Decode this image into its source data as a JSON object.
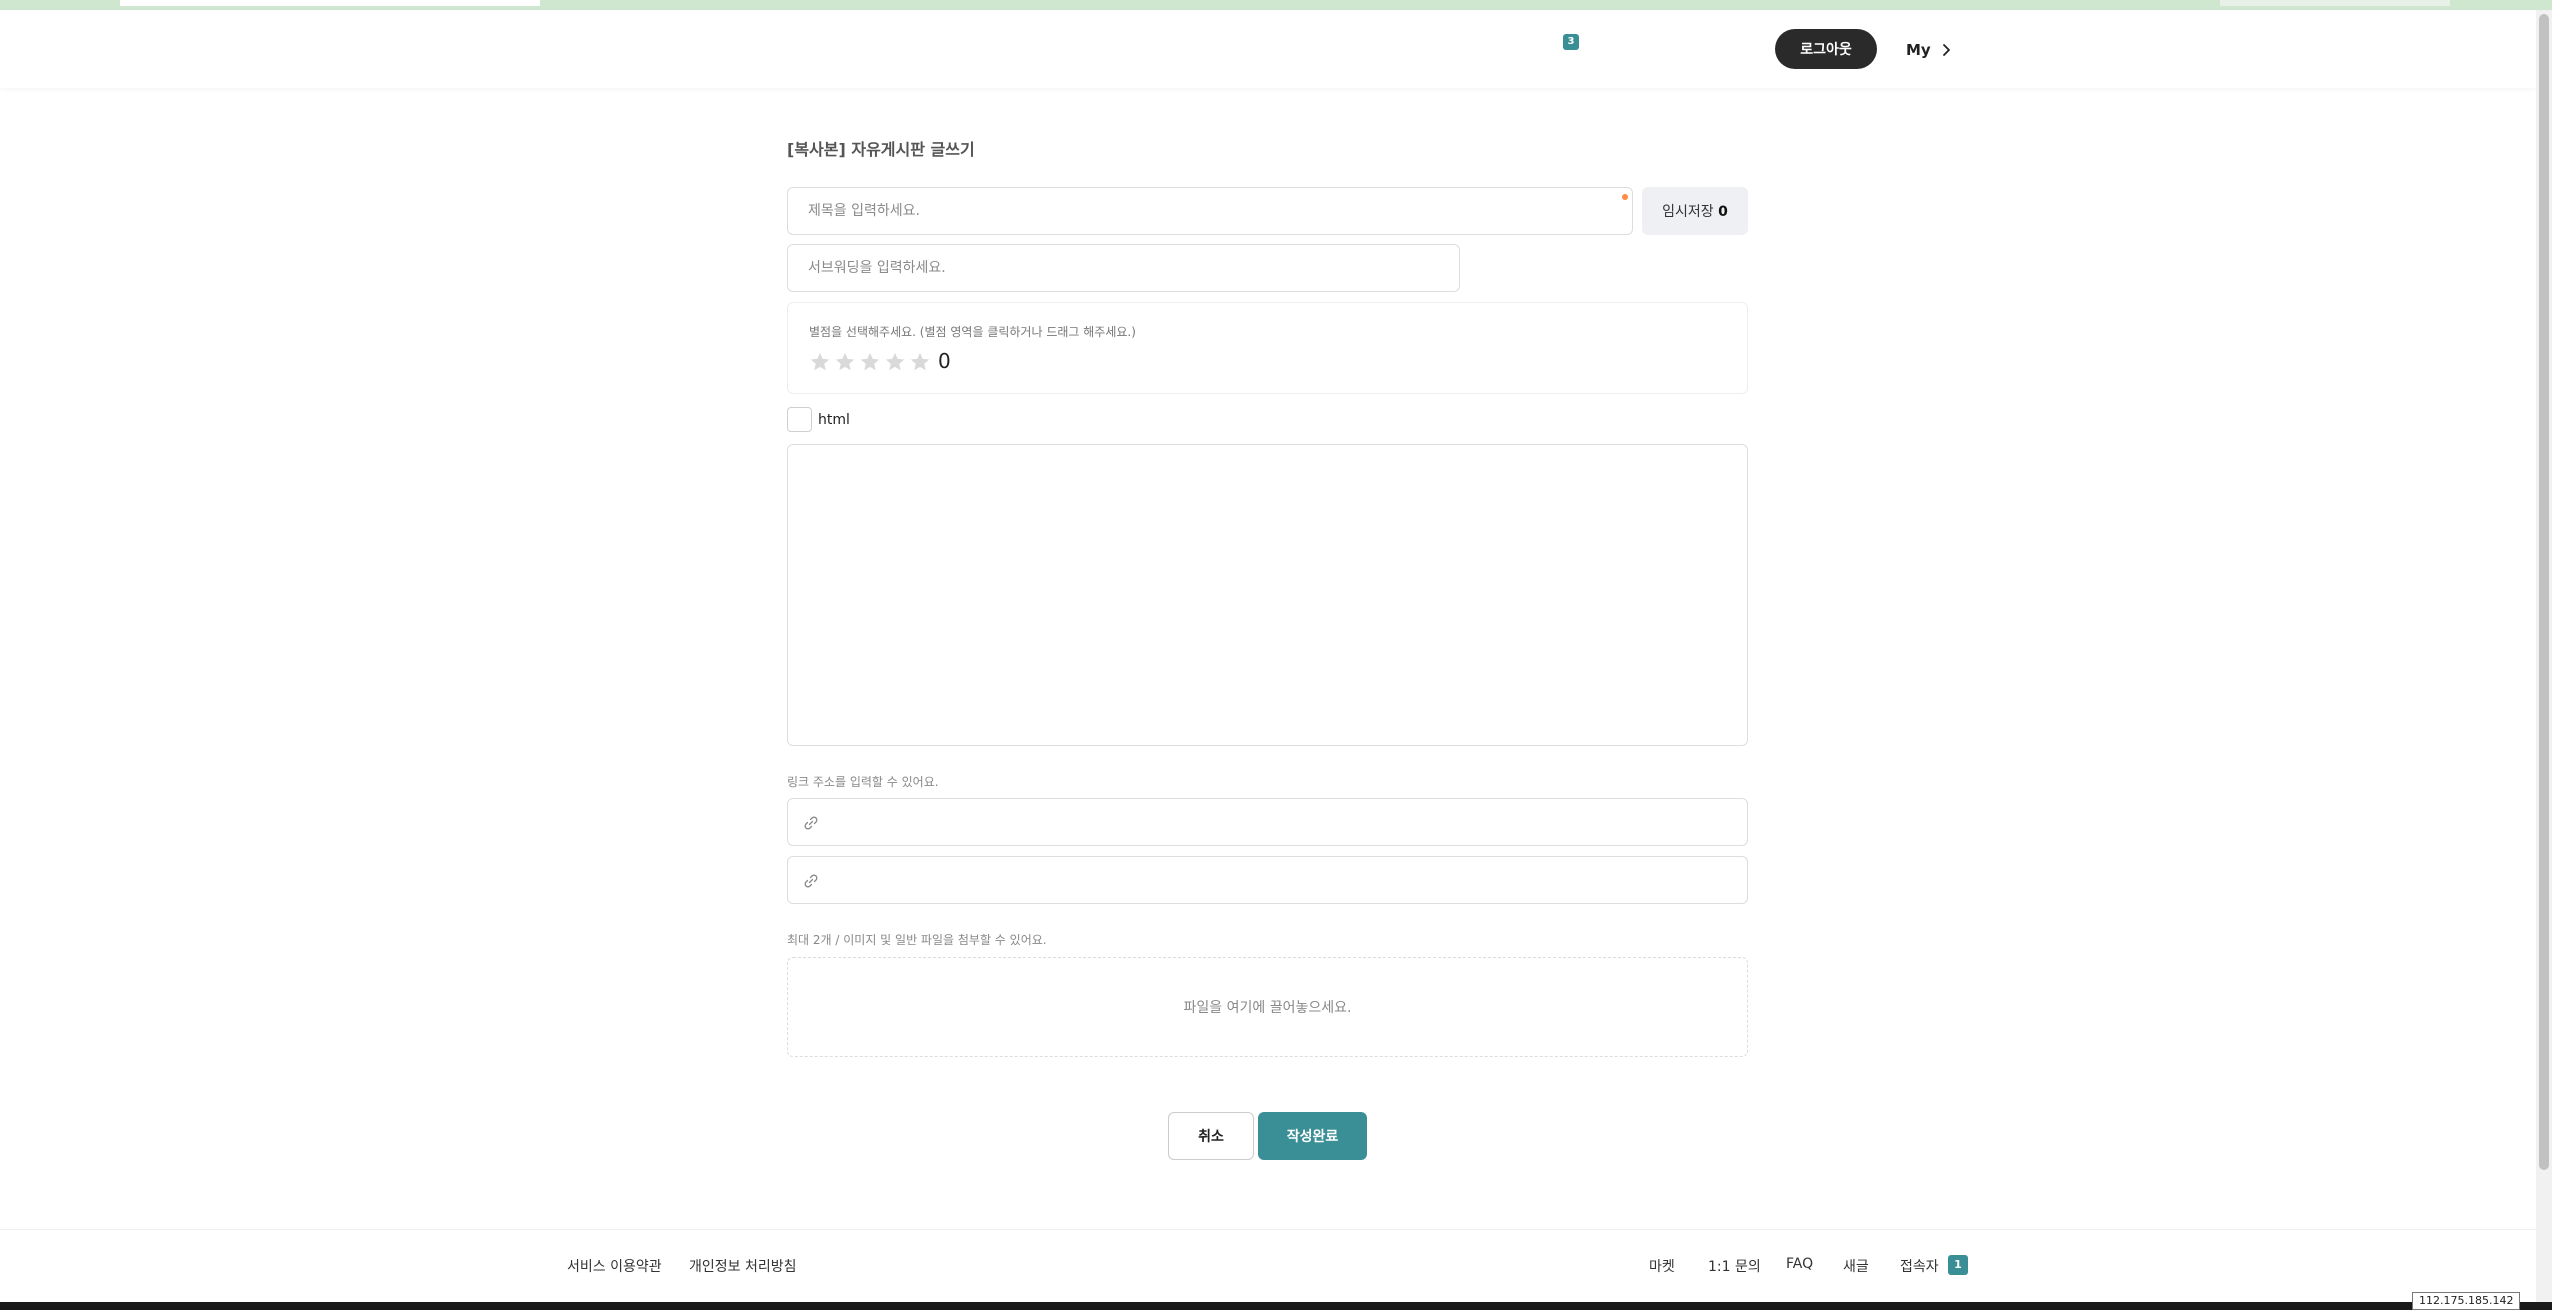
{
  "header": {
    "notification_count": "3",
    "logout_label": "로그아웃",
    "my_label": "My"
  },
  "form": {
    "page_title": "[복사본] 자유게시판 글쓰기",
    "title_placeholder": "제목을 입력하세요.",
    "temp_save_label": "임시저장",
    "temp_save_count": "0",
    "subtitle_placeholder": "서브워딩을 입력하세요.",
    "rating_hint": "별점을 선택해주세요. (별점 영역을 클릭하거나 드래그 해주세요.)",
    "rating_value": "0",
    "rating_max": 5,
    "html_label": "html",
    "link_hint": "링크 주소를 입력할 수 있어요.",
    "file_hint": "최대 2개 / 이미지 및 일반 파일을 첨부할 수 있어요.",
    "dropzone_text": "파일을 여기에 끌어놓으세요.",
    "cancel_label": "취소",
    "submit_label": "작성완료"
  },
  "footer": {
    "terms": "서비스 이용약관",
    "privacy": "개인정보 처리방침",
    "market": "마켓",
    "inquiry": "1:1 문의",
    "faq": "FAQ",
    "new_posts": "새글",
    "visitors_label": "접속자",
    "visitors_count": "1"
  },
  "ip_address": "112.175.185.142",
  "colors": {
    "accent": "#3a8e96",
    "dark_button": "#2a2a2a",
    "required_dot": "#ff8c42"
  }
}
